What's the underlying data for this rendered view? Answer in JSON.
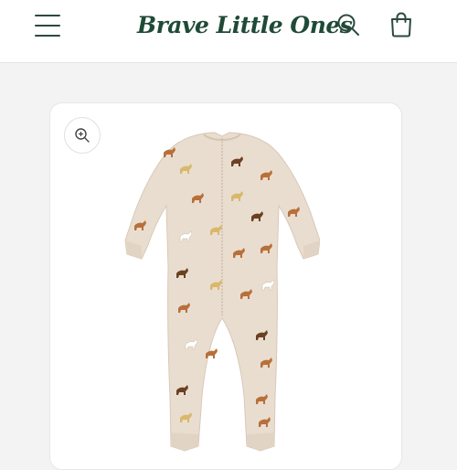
{
  "header": {
    "logo_text": "Brave Little Ones",
    "menu_icon": "hamburger-menu-icon",
    "search_icon": "search-icon",
    "cart_icon": "shopping-bag-icon"
  },
  "product": {
    "zoom_icon": "zoom-in-icon",
    "image": {
      "subject": "long-sleeve zip footless romper with horse print",
      "colors": {
        "fabric": "#e9ddd0",
        "print_brown": "#b8703a",
        "print_dark": "#6b4122",
        "print_tan": "#d9b86a"
      }
    }
  },
  "colors": {
    "brand_green": "#1f4a37",
    "page_bg": "#f3f3f3",
    "header_bg": "#ffffff"
  }
}
